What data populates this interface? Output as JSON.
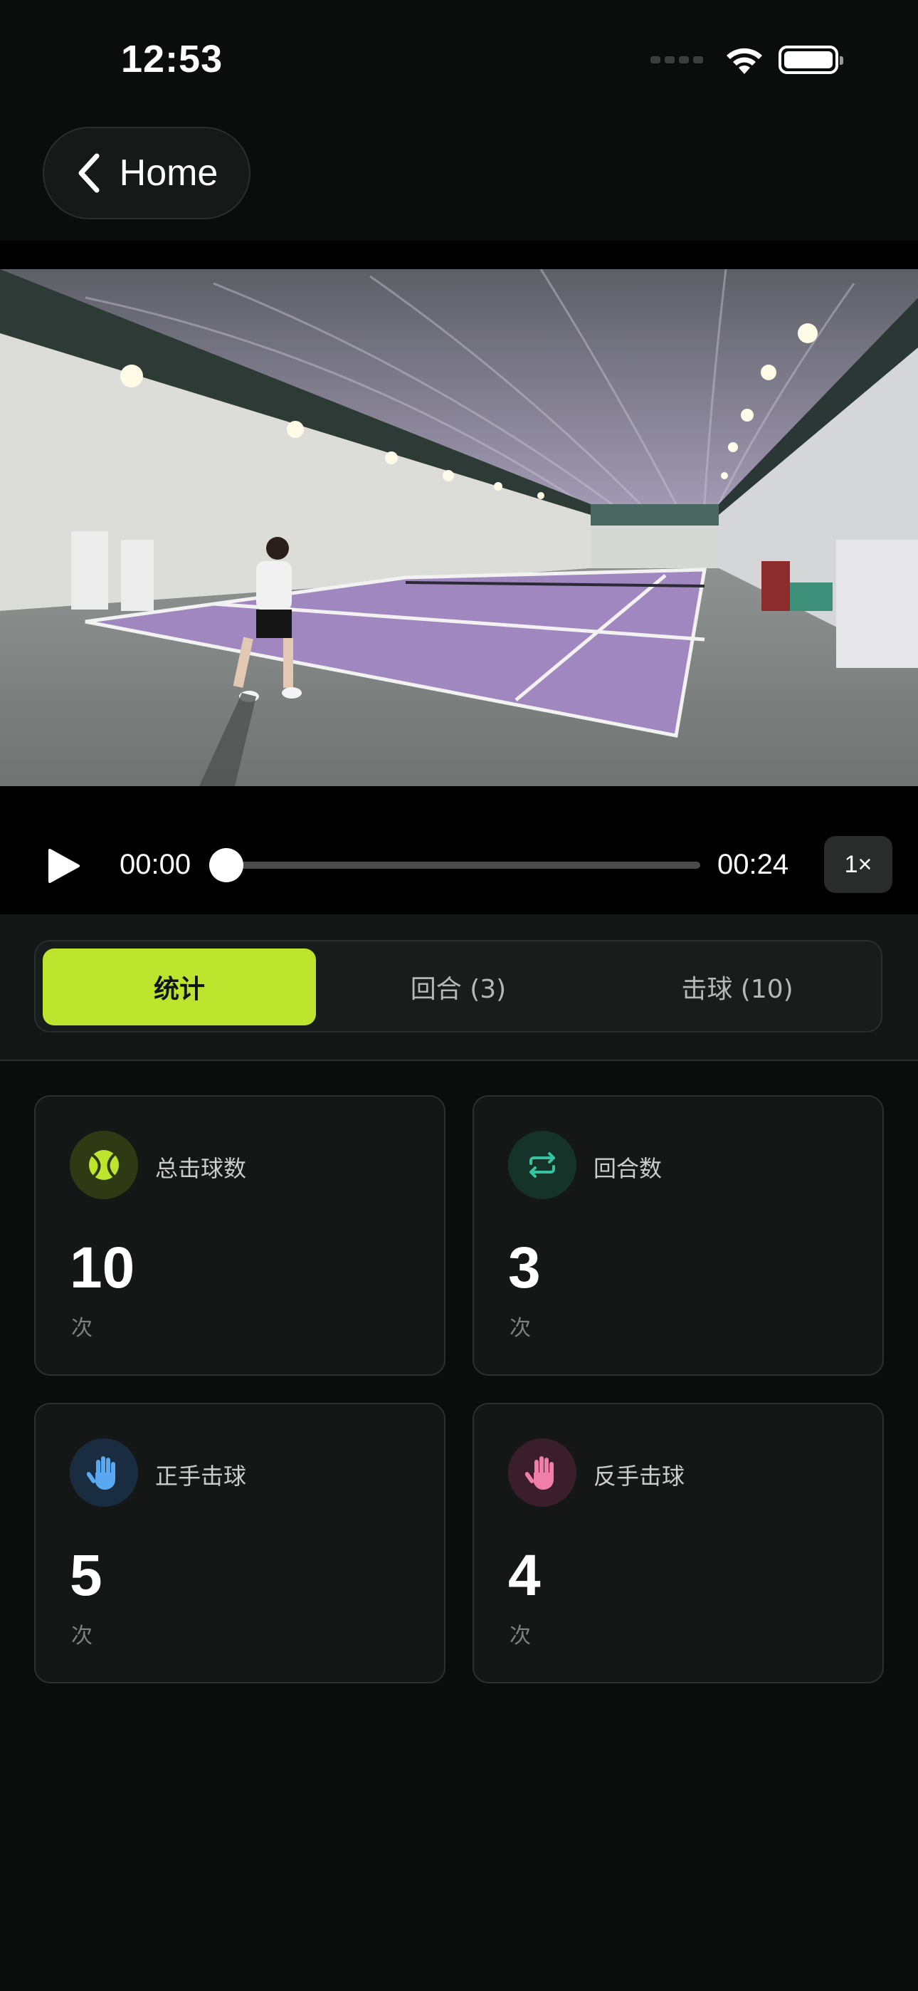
{
  "status_bar": {
    "time": "12:53"
  },
  "nav": {
    "back_label": "Home"
  },
  "player": {
    "current_time": "00:00",
    "total_time": "00:24",
    "progress": 0.0,
    "speed_label": "1×"
  },
  "tabs": [
    {
      "label": "统计",
      "active": true
    },
    {
      "label": "回合 (3)",
      "active": false
    },
    {
      "label": "击球 (10)",
      "active": false
    }
  ],
  "stats": [
    {
      "label": "总击球数",
      "value": "10",
      "unit": "次",
      "icon": "tennis-ball-icon",
      "icon_color": "#bde52e",
      "icon_bg": "#2f3a14"
    },
    {
      "label": "回合数",
      "value": "3",
      "unit": "次",
      "icon": "repeat-icon",
      "icon_color": "#36c3a2",
      "icon_bg": "#163329"
    },
    {
      "label": "正手击球",
      "value": "5",
      "unit": "次",
      "icon": "hand-icon",
      "icon_color": "#5aa8f0",
      "icon_bg": "#1a2c40"
    },
    {
      "label": "反手击球",
      "value": "4",
      "unit": "次",
      "icon": "hand-icon",
      "icon_color": "#ef7fa6",
      "icon_bg": "#3a1f2a"
    }
  ]
}
